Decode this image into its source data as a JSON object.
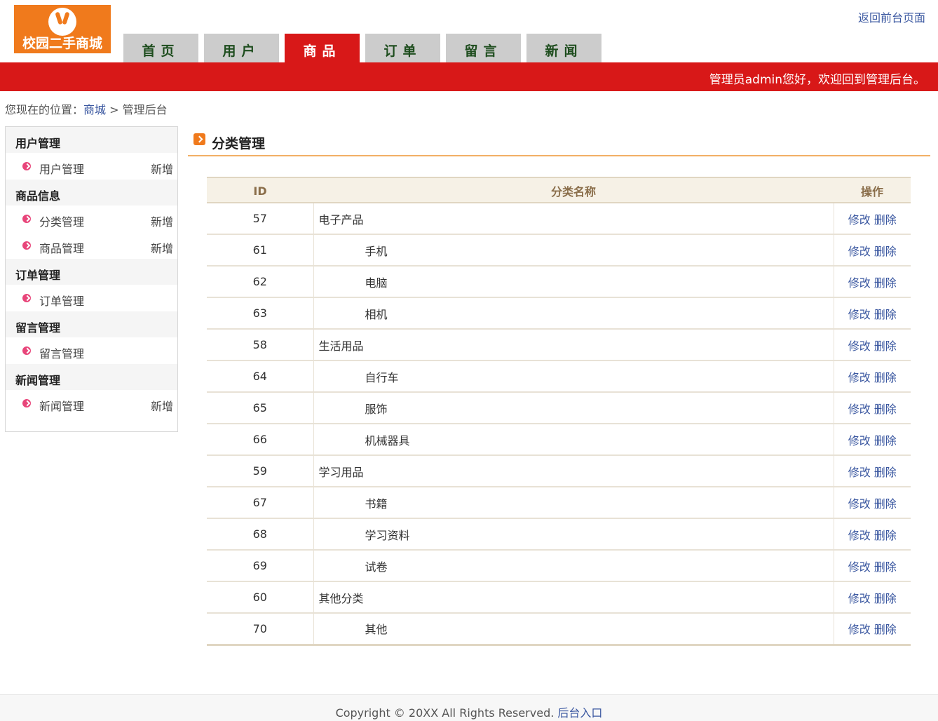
{
  "header": {
    "logo_text": "校园二手商城",
    "front_link": "返回前台页面",
    "welcome": "管理员admin您好，欢迎回到管理后台。"
  },
  "nav": [
    {
      "label": "首页",
      "active": false
    },
    {
      "label": "用户",
      "active": false
    },
    {
      "label": "商品",
      "active": true
    },
    {
      "label": "订单",
      "active": false
    },
    {
      "label": "留言",
      "active": false
    },
    {
      "label": "新闻",
      "active": false
    }
  ],
  "breadcrumb": {
    "prefix": "您现在的位置：",
    "link": "商城",
    "separator": " > ",
    "current": "管理后台"
  },
  "sidebar": [
    {
      "title": "用户管理",
      "items": [
        {
          "label": "用户管理",
          "add": "新增"
        }
      ]
    },
    {
      "title": "商品信息",
      "items": [
        {
          "label": "分类管理",
          "add": "新增"
        },
        {
          "label": "商品管理",
          "add": "新增"
        }
      ]
    },
    {
      "title": "订单管理",
      "items": [
        {
          "label": "订单管理",
          "add": ""
        }
      ]
    },
    {
      "title": "留言管理",
      "items": [
        {
          "label": "留言管理",
          "add": ""
        }
      ]
    },
    {
      "title": "新闻管理",
      "items": [
        {
          "label": "新闻管理",
          "add": "新增"
        }
      ]
    }
  ],
  "main": {
    "title": "分类管理",
    "columns": [
      "ID",
      "分类名称",
      "操作"
    ],
    "edit_label": "修改",
    "delete_label": "删除",
    "rows": [
      {
        "id": "57",
        "name": "电子产品",
        "child": false
      },
      {
        "id": "61",
        "name": "手机",
        "child": true
      },
      {
        "id": "62",
        "name": "电脑",
        "child": true
      },
      {
        "id": "63",
        "name": "相机",
        "child": true
      },
      {
        "id": "58",
        "name": "生活用品",
        "child": false
      },
      {
        "id": "64",
        "name": "自行车",
        "child": true
      },
      {
        "id": "65",
        "name": "服饰",
        "child": true
      },
      {
        "id": "66",
        "name": "机械器具",
        "child": true
      },
      {
        "id": "59",
        "name": "学习用品",
        "child": false
      },
      {
        "id": "67",
        "name": "书籍",
        "child": true
      },
      {
        "id": "68",
        "name": "学习资料",
        "child": true
      },
      {
        "id": "69",
        "name": "试卷",
        "child": true
      },
      {
        "id": "60",
        "name": "其他分类",
        "child": false
      },
      {
        "id": "70",
        "name": "其他",
        "child": true
      }
    ]
  },
  "footer": {
    "copyright": "Copyright © 20XX All Rights Reserved. ",
    "admin_link": "后台入口"
  },
  "colors": {
    "brand_red": "#d81818",
    "logo_orange": "#f07a1c",
    "link_blue": "#3a57a0",
    "header_bg": "#f6f1e6"
  }
}
